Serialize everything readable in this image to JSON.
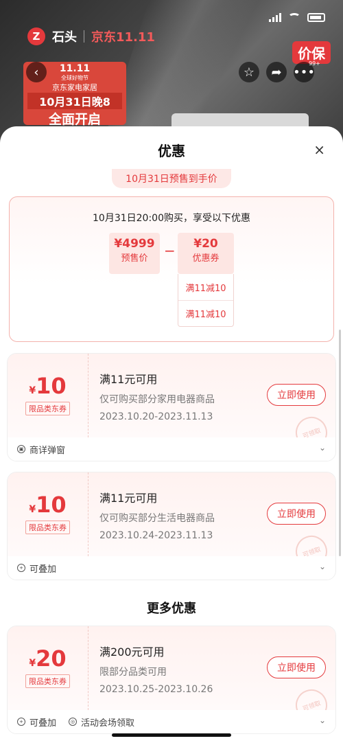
{
  "background": {
    "brand_logo": "Z",
    "brand_name": "石头",
    "brand_jd": "京东11.11",
    "price_protect": "价保",
    "more_badge": "99+",
    "promo": {
      "line1": "11.11",
      "line2": "全球好物节",
      "line3": "京东家电家居",
      "line4": "10月31日晚8",
      "line5": "全面开启"
    },
    "icons": [
      "back-icon",
      "star-icon",
      "share-icon",
      "more-icon"
    ]
  },
  "sheet": {
    "title": "优惠",
    "close_label": "×",
    "presale_tab": "10月31日预售到手价",
    "presale": {
      "description": "10月31日20:00购买，享受以下优惠",
      "price_amount": "¥4999",
      "price_label": "预售价",
      "minus": "−",
      "coupon_amount": "¥20",
      "coupon_label": "优惠券",
      "sub_items": [
        "满11减10",
        "满11减10"
      ]
    },
    "coupons": [
      {
        "yen": "¥",
        "amount": "10",
        "tag": "限品类东券",
        "title": "满11元可用",
        "subtitle": "仅可购买部分家用电器商品",
        "date": "2023.10.20-2023.11.13",
        "button": "立即使用",
        "stamp": "可领取",
        "features": [
          "商详弹窗"
        ]
      },
      {
        "yen": "¥",
        "amount": "10",
        "tag": "限品类东券",
        "title": "满11元可用",
        "subtitle": "仅可购买部分生活电器商品",
        "date": "2023.10.24-2023.11.13",
        "button": "立即使用",
        "stamp": "可领取",
        "features": [
          "可叠加"
        ]
      },
      {
        "yen": "¥",
        "amount": "20",
        "tag": "限品类东券",
        "title": "满200元可用",
        "subtitle": "限部分品类可用",
        "date": "2023.10.25-2023.10.26",
        "button": "立即使用",
        "stamp": "可领取",
        "features": [
          "可叠加",
          "活动会场领取"
        ]
      }
    ],
    "more_title": "更多优惠"
  },
  "colors": {
    "accent": "#e4393c",
    "accent_soft": "#fde6e3"
  }
}
